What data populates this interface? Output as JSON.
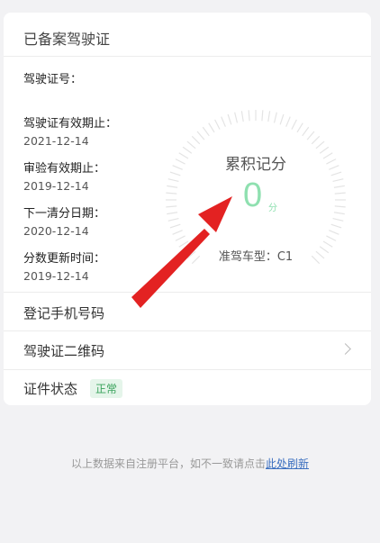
{
  "card": {
    "title": "已备案驾驶证",
    "info": [
      {
        "label": "驾驶证号：",
        "value": ""
      },
      {
        "label": "驾驶证有效期止：",
        "value": "2021-12-14"
      },
      {
        "label": "审验有效期止：",
        "value": "2019-12-14"
      },
      {
        "label": "下一清分日期：",
        "value": "2020-12-14"
      },
      {
        "label": "分数更新时间：",
        "value": "2019-12-14"
      }
    ],
    "gauge": {
      "label": "累积记分",
      "score": "0",
      "unit": "分",
      "car_type": "准驾车型：C1"
    },
    "rows": {
      "phone": "登记手机号码",
      "qrcode": "驾驶证二维码",
      "status_label": "证件状态",
      "status_badge": "正常"
    }
  },
  "footer": {
    "text": "以上数据来自注册平台，如不一致请点击",
    "link": "此处刷新"
  },
  "colors": {
    "accent_green": "#8fe0b0",
    "badge_green": "#3aa35c",
    "link_blue": "#3b6fbf",
    "arrow_red": "#e32222"
  }
}
